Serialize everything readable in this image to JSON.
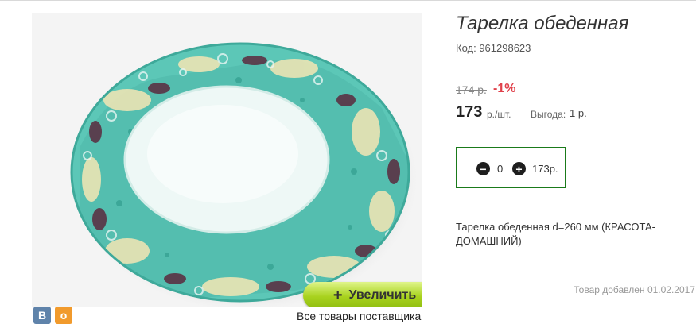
{
  "product": {
    "title": "Тарелка обеденная",
    "code": "Код: 961298623",
    "old_price": "174 р.",
    "discount": "-1%",
    "price": "173",
    "unit": "р./шт.",
    "profit_label": "Выгода:",
    "profit_value": "1 р.",
    "description": "Тарелка обеденная d=260 мм (КРАСОТА-ДОМАШНИЙ)",
    "added": "Товар добавлен 01.02.2017"
  },
  "cart": {
    "quantity": "0",
    "sum": "173р.",
    "minus_icon": "minus-circle-icon",
    "plus_icon": "plus-circle-icon"
  },
  "image": {
    "zoom_label": "Увеличить",
    "zoom_icon": "plus-icon"
  },
  "social": {
    "vk_label": "В",
    "ok_label": "о"
  },
  "links": {
    "all_goods": "Все товары поставщика"
  },
  "colors": {
    "border_green": "#1a7a1a",
    "discount_red": "#e0404a",
    "button_green": "#a8d21e"
  }
}
